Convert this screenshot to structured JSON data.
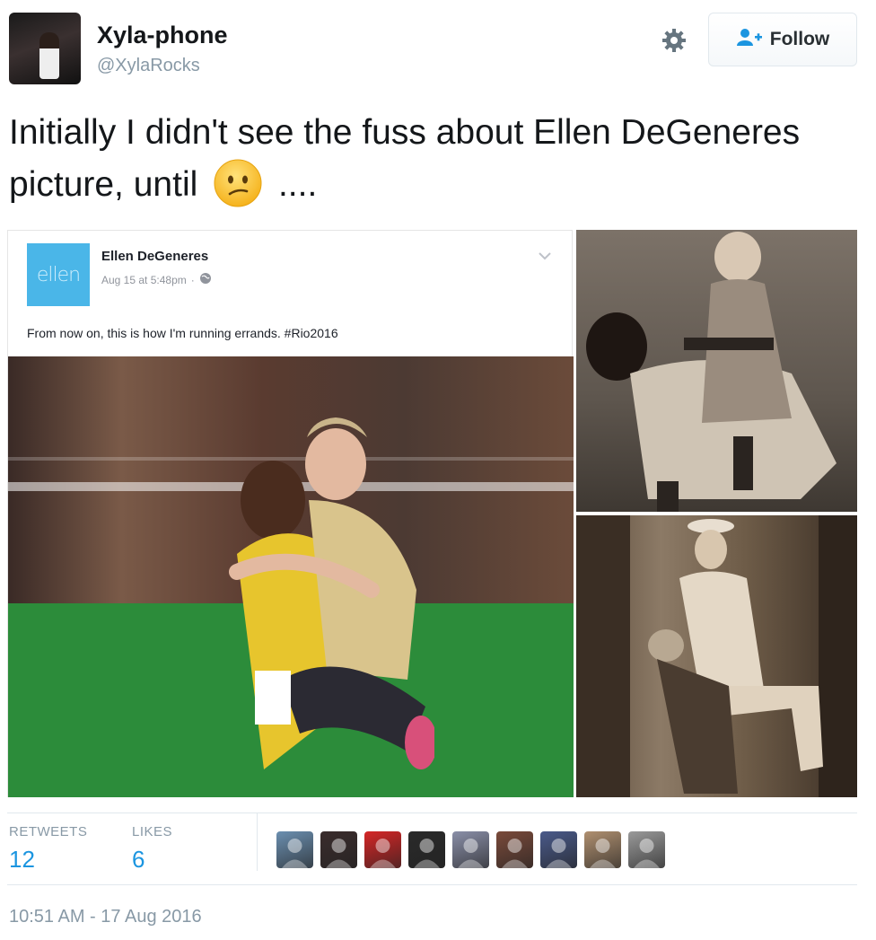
{
  "user": {
    "name": "Xyla-phone",
    "handle": "@XylaRocks"
  },
  "actions": {
    "follow_label": "Follow"
  },
  "tweet": {
    "text_before": "Initially I didn't see the fuss about Ellen DeGeneres picture, until",
    "text_after": "....",
    "emoji": "confused-face"
  },
  "embedded_post": {
    "page_name": "Ellen DeGeneres",
    "logo_text": "ellen",
    "date": "Aug 15 at 5:48pm",
    "separator": "·",
    "caption": "From now on, this is how I'm running errands. #Rio2016"
  },
  "stats": {
    "retweets_label": "RETWEETS",
    "retweets_value": "12",
    "likes_label": "LIKES",
    "likes_value": "6"
  },
  "likers": [
    {
      "name": "liker-1",
      "color": "#6b8fb0"
    },
    {
      "name": "liker-2",
      "color": "#3a2c2c"
    },
    {
      "name": "liker-3",
      "color": "#d62626"
    },
    {
      "name": "liker-4",
      "color": "#2a2a2a"
    },
    {
      "name": "liker-5",
      "color": "#8a8fa8"
    },
    {
      "name": "liker-6",
      "color": "#7a4a3a"
    },
    {
      "name": "liker-7",
      "color": "#4a5a8a"
    },
    {
      "name": "liker-8",
      "color": "#b09070"
    },
    {
      "name": "liker-9",
      "color": "#9a9a9a"
    }
  ],
  "timestamp": "10:51 AM - 17 Aug 2016",
  "colors": {
    "link_blue": "#1b95e0",
    "muted": "#8899a6",
    "ellen_blue": "#4ab6e8"
  }
}
